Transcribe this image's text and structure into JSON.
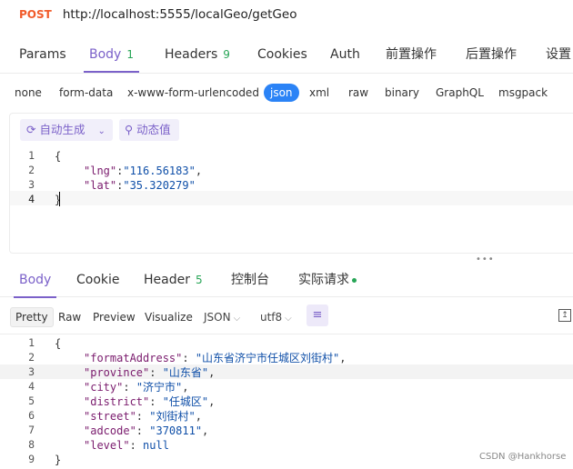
{
  "request": {
    "method": "POST",
    "url": "http://localhost:5555/localGeo/getGeo"
  },
  "req_tabs": [
    {
      "label": "Params",
      "count": ""
    },
    {
      "label": "Body",
      "count": "1"
    },
    {
      "label": "Headers",
      "count": "9"
    },
    {
      "label": "Cookies",
      "count": ""
    },
    {
      "label": "Auth",
      "count": ""
    },
    {
      "label": "前置操作",
      "count": ""
    },
    {
      "label": "后置操作",
      "count": ""
    },
    {
      "label": "设置",
      "count": ""
    }
  ],
  "body_types": [
    "none",
    "form-data",
    "x-www-form-urlencoded",
    "json",
    "xml",
    "raw",
    "binary",
    "GraphQL",
    "msgpack"
  ],
  "editor_tools": {
    "auto_generate": "自动生成",
    "dynamic_value": "动态值"
  },
  "request_body": {
    "line_numbers": [
      "1",
      "2",
      "3",
      "4"
    ],
    "open": "{",
    "lng_key": "\"lng\"",
    "lng_val": "\"116.56183\"",
    "lat_key": "\"lat\"",
    "lat_val": "\"35.320279\"",
    "close": "}"
  },
  "resp_tabs": [
    {
      "label": "Body",
      "count": ""
    },
    {
      "label": "Cookie",
      "count": ""
    },
    {
      "label": "Header",
      "count": "5"
    },
    {
      "label": "控制台",
      "count": ""
    },
    {
      "label": "实际请求",
      "count": ""
    }
  ],
  "resp_views": [
    "Pretty",
    "Raw",
    "Preview",
    "Visualize"
  ],
  "resp_format": "JSON",
  "resp_encoding": "utf8",
  "response_body": {
    "line_numbers": [
      "1",
      "2",
      "3",
      "4",
      "5",
      "6",
      "7",
      "8",
      "9"
    ],
    "open": "{",
    "fields": [
      {
        "key": "\"formatAddress\"",
        "value": "\"山东省济宁市任城区刘街村\"",
        "comma": ","
      },
      {
        "key": "\"province\"",
        "value": "\"山东省\"",
        "comma": ","
      },
      {
        "key": "\"city\"",
        "value": "\"济宁市\"",
        "comma": ","
      },
      {
        "key": "\"district\"",
        "value": "\"任城区\"",
        "comma": ","
      },
      {
        "key": "\"street\"",
        "value": "\"刘街村\"",
        "comma": ","
      },
      {
        "key": "\"adcode\"",
        "value": "\"370811\"",
        "comma": ","
      },
      {
        "key": "\"level\"",
        "value": "null",
        "comma": ""
      }
    ],
    "close": "}"
  },
  "watermark": "CSDN @Hankhorse",
  "colors": {
    "accent": "#7b61c9",
    "method": "#f15b2a",
    "count": "#27a556",
    "json_active": "#2b83f6"
  }
}
